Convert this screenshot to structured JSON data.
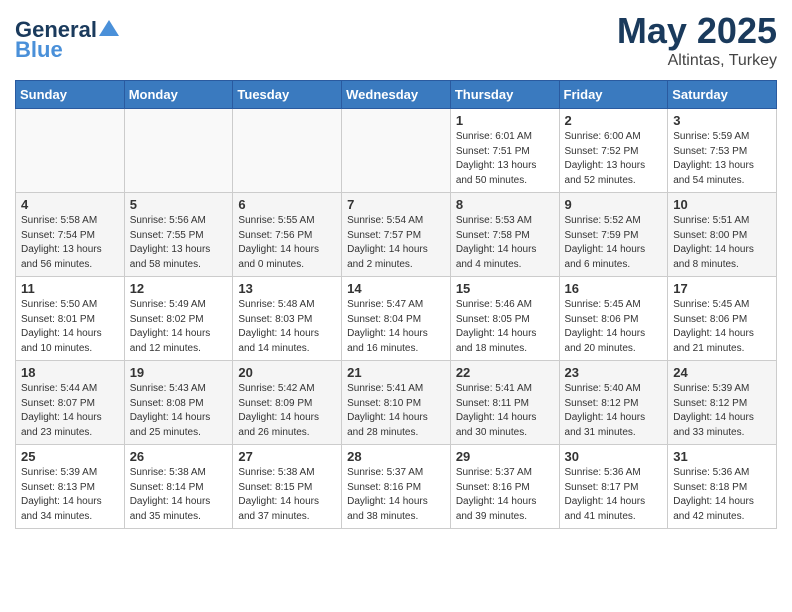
{
  "header": {
    "logo_line1": "General",
    "logo_line2": "Blue",
    "title": "May 2025",
    "subtitle": "Altintas, Turkey"
  },
  "days_of_week": [
    "Sunday",
    "Monday",
    "Tuesday",
    "Wednesday",
    "Thursday",
    "Friday",
    "Saturday"
  ],
  "weeks": [
    [
      {
        "num": "",
        "info": ""
      },
      {
        "num": "",
        "info": ""
      },
      {
        "num": "",
        "info": ""
      },
      {
        "num": "",
        "info": ""
      },
      {
        "num": "1",
        "info": "Sunrise: 6:01 AM\nSunset: 7:51 PM\nDaylight: 13 hours\nand 50 minutes."
      },
      {
        "num": "2",
        "info": "Sunrise: 6:00 AM\nSunset: 7:52 PM\nDaylight: 13 hours\nand 52 minutes."
      },
      {
        "num": "3",
        "info": "Sunrise: 5:59 AM\nSunset: 7:53 PM\nDaylight: 13 hours\nand 54 minutes."
      }
    ],
    [
      {
        "num": "4",
        "info": "Sunrise: 5:58 AM\nSunset: 7:54 PM\nDaylight: 13 hours\nand 56 minutes."
      },
      {
        "num": "5",
        "info": "Sunrise: 5:56 AM\nSunset: 7:55 PM\nDaylight: 13 hours\nand 58 minutes."
      },
      {
        "num": "6",
        "info": "Sunrise: 5:55 AM\nSunset: 7:56 PM\nDaylight: 14 hours\nand 0 minutes."
      },
      {
        "num": "7",
        "info": "Sunrise: 5:54 AM\nSunset: 7:57 PM\nDaylight: 14 hours\nand 2 minutes."
      },
      {
        "num": "8",
        "info": "Sunrise: 5:53 AM\nSunset: 7:58 PM\nDaylight: 14 hours\nand 4 minutes."
      },
      {
        "num": "9",
        "info": "Sunrise: 5:52 AM\nSunset: 7:59 PM\nDaylight: 14 hours\nand 6 minutes."
      },
      {
        "num": "10",
        "info": "Sunrise: 5:51 AM\nSunset: 8:00 PM\nDaylight: 14 hours\nand 8 minutes."
      }
    ],
    [
      {
        "num": "11",
        "info": "Sunrise: 5:50 AM\nSunset: 8:01 PM\nDaylight: 14 hours\nand 10 minutes."
      },
      {
        "num": "12",
        "info": "Sunrise: 5:49 AM\nSunset: 8:02 PM\nDaylight: 14 hours\nand 12 minutes."
      },
      {
        "num": "13",
        "info": "Sunrise: 5:48 AM\nSunset: 8:03 PM\nDaylight: 14 hours\nand 14 minutes."
      },
      {
        "num": "14",
        "info": "Sunrise: 5:47 AM\nSunset: 8:04 PM\nDaylight: 14 hours\nand 16 minutes."
      },
      {
        "num": "15",
        "info": "Sunrise: 5:46 AM\nSunset: 8:05 PM\nDaylight: 14 hours\nand 18 minutes."
      },
      {
        "num": "16",
        "info": "Sunrise: 5:45 AM\nSunset: 8:06 PM\nDaylight: 14 hours\nand 20 minutes."
      },
      {
        "num": "17",
        "info": "Sunrise: 5:45 AM\nSunset: 8:06 PM\nDaylight: 14 hours\nand 21 minutes."
      }
    ],
    [
      {
        "num": "18",
        "info": "Sunrise: 5:44 AM\nSunset: 8:07 PM\nDaylight: 14 hours\nand 23 minutes."
      },
      {
        "num": "19",
        "info": "Sunrise: 5:43 AM\nSunset: 8:08 PM\nDaylight: 14 hours\nand 25 minutes."
      },
      {
        "num": "20",
        "info": "Sunrise: 5:42 AM\nSunset: 8:09 PM\nDaylight: 14 hours\nand 26 minutes."
      },
      {
        "num": "21",
        "info": "Sunrise: 5:41 AM\nSunset: 8:10 PM\nDaylight: 14 hours\nand 28 minutes."
      },
      {
        "num": "22",
        "info": "Sunrise: 5:41 AM\nSunset: 8:11 PM\nDaylight: 14 hours\nand 30 minutes."
      },
      {
        "num": "23",
        "info": "Sunrise: 5:40 AM\nSunset: 8:12 PM\nDaylight: 14 hours\nand 31 minutes."
      },
      {
        "num": "24",
        "info": "Sunrise: 5:39 AM\nSunset: 8:12 PM\nDaylight: 14 hours\nand 33 minutes."
      }
    ],
    [
      {
        "num": "25",
        "info": "Sunrise: 5:39 AM\nSunset: 8:13 PM\nDaylight: 14 hours\nand 34 minutes."
      },
      {
        "num": "26",
        "info": "Sunrise: 5:38 AM\nSunset: 8:14 PM\nDaylight: 14 hours\nand 35 minutes."
      },
      {
        "num": "27",
        "info": "Sunrise: 5:38 AM\nSunset: 8:15 PM\nDaylight: 14 hours\nand 37 minutes."
      },
      {
        "num": "28",
        "info": "Sunrise: 5:37 AM\nSunset: 8:16 PM\nDaylight: 14 hours\nand 38 minutes."
      },
      {
        "num": "29",
        "info": "Sunrise: 5:37 AM\nSunset: 8:16 PM\nDaylight: 14 hours\nand 39 minutes."
      },
      {
        "num": "30",
        "info": "Sunrise: 5:36 AM\nSunset: 8:17 PM\nDaylight: 14 hours\nand 41 minutes."
      },
      {
        "num": "31",
        "info": "Sunrise: 5:36 AM\nSunset: 8:18 PM\nDaylight: 14 hours\nand 42 minutes."
      }
    ]
  ]
}
